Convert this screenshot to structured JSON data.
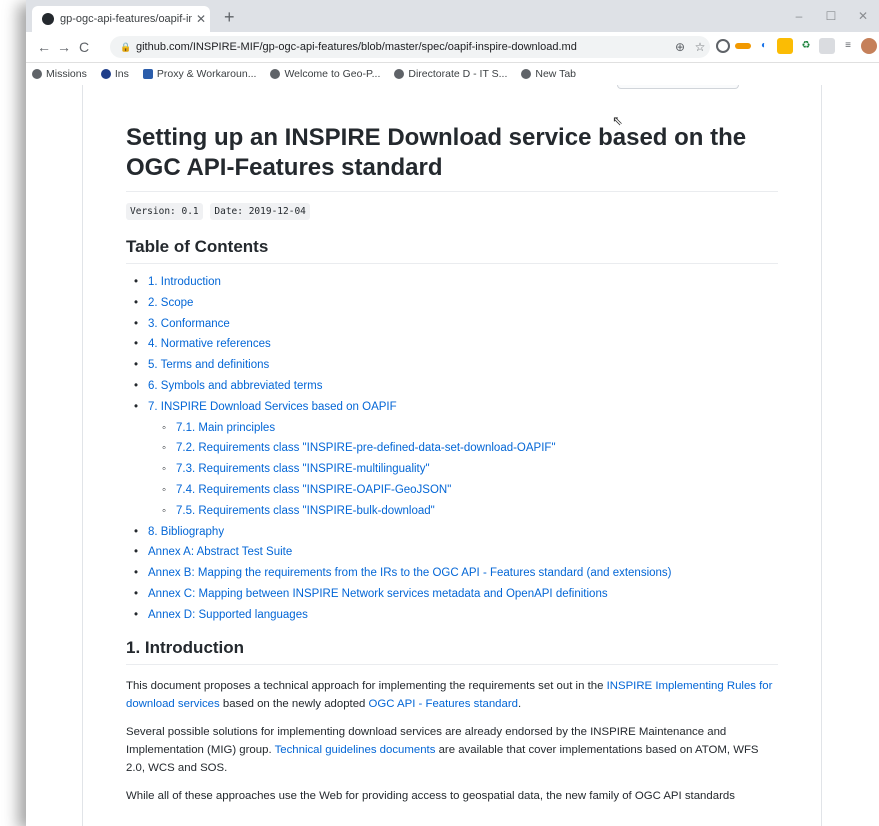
{
  "browser": {
    "tab_title": "gp-ogc-api-features/oapif-inspi",
    "tab_close": "✕",
    "new_tab": "+",
    "window_controls": [
      "–",
      "☐",
      "✕"
    ],
    "nav": {
      "back": "←",
      "forward": "→",
      "reload": "C"
    },
    "url": "github.com/INSPIRE-MIF/gp-ogc-api-features/blob/master/spec/oapif-inspire-download.md",
    "bookmarks": [
      "Missions",
      "Ins",
      "Proxy & Workaroun...",
      "Welcome to Geo-P...",
      "Directorate D - IT S...",
      "New Tab"
    ]
  },
  "article": {
    "title": "Setting up an INSPIRE Download service based on the OGC API-Features standard",
    "version": "Version: 0.1",
    "date": "Date: 2019-12-04",
    "toc_heading": "Table of Contents",
    "toc": [
      {
        "label": "1. Introduction",
        "level": 1
      },
      {
        "label": "2. Scope",
        "level": 1
      },
      {
        "label": "3. Conformance",
        "level": 1
      },
      {
        "label": "4. Normative references",
        "level": 1
      },
      {
        "label": "5. Terms and definitions",
        "level": 1
      },
      {
        "label": "6. Symbols and abbreviated terms",
        "level": 1
      },
      {
        "label": "7. INSPIRE Download Services based on OAPIF",
        "level": 1
      },
      {
        "label": "7.1. Main principles",
        "level": 2
      },
      {
        "label": "7.2. Requirements class \"INSPIRE-pre-defined-data-set-download-OAPIF\"",
        "level": 2
      },
      {
        "label": "7.3. Requirements class \"INSPIRE-multilinguality\"",
        "level": 2
      },
      {
        "label": "7.4. Requirements class \"INSPIRE-OAPIF-GeoJSON\"",
        "level": 2
      },
      {
        "label": "7.5. Requirements class \"INSPIRE-bulk-download\"",
        "level": 2
      },
      {
        "label": "8. Bibliography",
        "level": 1
      },
      {
        "label": "Annex A: Abstract Test Suite",
        "level": 1
      },
      {
        "label": "Annex B: Mapping the requirements from the IRs to the OGC API - Features standard (and extensions)",
        "level": 1
      },
      {
        "label": "Annex C: Mapping between INSPIRE Network services metadata and OpenAPI definitions",
        "level": 1
      },
      {
        "label": "Annex D: Supported languages",
        "level": 1
      }
    ],
    "intro_heading": "1. Introduction",
    "p1": {
      "t1": "This document proposes a technical approach for implementing the requirements set out in the ",
      "l1": "INSPIRE Implementing Rules for download services",
      "t2": " based on the newly adopted ",
      "l2": "OGC API - Features standard",
      "t3": "."
    },
    "p2": {
      "t1": "Several possible solutions for implementing download services are already endorsed by the INSPIRE Maintenance and Implementation (MIG) group. ",
      "l1": "Technical guidelines documents",
      "t2": " are available that cover implementations based on ATOM, WFS 2.0, WCS and SOS."
    },
    "p3": "While all of these approaches use the Web for providing access to geospatial data, the new family of OGC API standards"
  }
}
